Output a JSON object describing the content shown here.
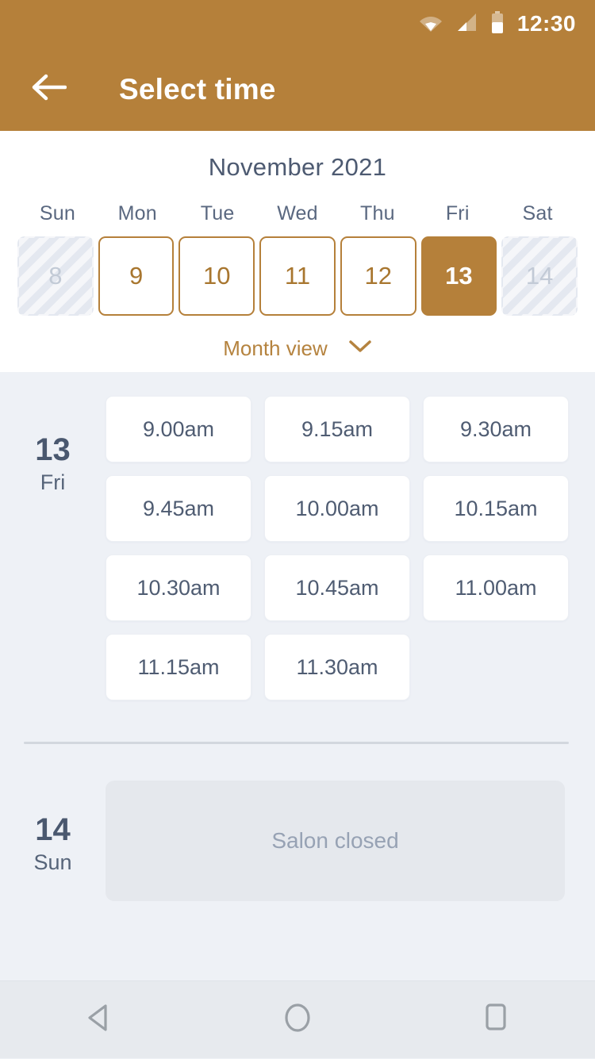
{
  "status_bar": {
    "time": "12:30",
    "icons": [
      "wifi-icon",
      "cellular-signal-icon",
      "battery-icon"
    ]
  },
  "app_bar": {
    "back_icon": "arrow-left-icon",
    "title": "Select time",
    "background_color": "#b5803a"
  },
  "calendar": {
    "month_title": "November 2021",
    "weekdays": [
      "Sun",
      "Mon",
      "Tue",
      "Wed",
      "Thu",
      "Fri",
      "Sat"
    ],
    "days": [
      {
        "number": "8",
        "state": "disabled"
      },
      {
        "number": "9",
        "state": "available"
      },
      {
        "number": "10",
        "state": "available"
      },
      {
        "number": "11",
        "state": "available"
      },
      {
        "number": "12",
        "state": "available"
      },
      {
        "number": "13",
        "state": "selected"
      },
      {
        "number": "14",
        "state": "disabled"
      }
    ],
    "view_toggle": {
      "label": "Month view",
      "icon": "chevron-down-icon"
    },
    "accent_color": "#b5803a",
    "title_color": "#4d5a71"
  },
  "schedule": [
    {
      "day_number": "13",
      "day_name": "Fri",
      "slots": [
        "9.00am",
        "9.15am",
        "9.30am",
        "9.45am",
        "10.00am",
        "10.15am",
        "10.30am",
        "10.45am",
        "11.00am",
        "11.15am",
        "11.30am"
      ],
      "closed_message": ""
    },
    {
      "day_number": "14",
      "day_name": "Sun",
      "slots": [],
      "closed_message": "Salon closed"
    }
  ],
  "nav_bar": {
    "buttons": [
      "back-triangle-icon",
      "home-circle-icon",
      "recents-square-icon"
    ]
  }
}
